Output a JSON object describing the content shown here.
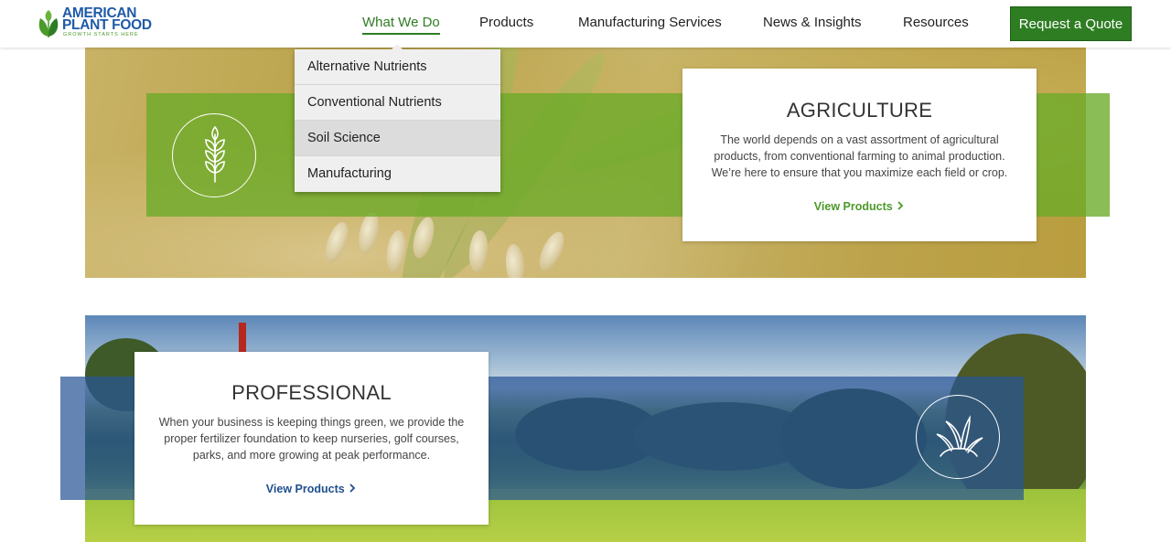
{
  "header": {
    "logo": {
      "name_line1": "AMERICAN",
      "name_line2": "PLANT FOOD",
      "tagline": "GROWTH STARTS HERE"
    },
    "nav": [
      {
        "label": "What We Do",
        "active": true
      },
      {
        "label": "Products"
      },
      {
        "label": "Manufacturing Services"
      },
      {
        "label": "News & Insights"
      },
      {
        "label": "Resources"
      }
    ],
    "cta_label": "Request a Quote"
  },
  "dropdown": {
    "items": [
      {
        "label": "Alternative Nutrients"
      },
      {
        "label": "Conventional Nutrients"
      },
      {
        "label": "Soil Science",
        "hovered": true
      },
      {
        "label": "Manufacturing"
      }
    ]
  },
  "sections": {
    "agriculture": {
      "title": "AGRICULTURE",
      "body_line1": "The world depends on a vast assortment of agricultural",
      "body_line2": "products, from conventional farming to animal production.",
      "body_line3": "We’re here to ensure that you maximize each field or crop.",
      "link": "View Products",
      "icon": "wheat-icon",
      "accent": "#6aaa28"
    },
    "professional": {
      "title": "PROFESSIONAL",
      "body_line1": "When your business is keeping things green, we provide the",
      "body_line2": "proper fertilizer foundation to keep nurseries, golf courses,",
      "body_line3": "parks, and more growing at peak performance.",
      "link": "View Products",
      "icon": "grass-icon",
      "accent": "#285596"
    }
  },
  "colors": {
    "brand_blue": "#1f5aa8",
    "brand_green": "#2e7d23",
    "link_green": "#4c9a2a",
    "link_blue": "#1f4f8f"
  }
}
